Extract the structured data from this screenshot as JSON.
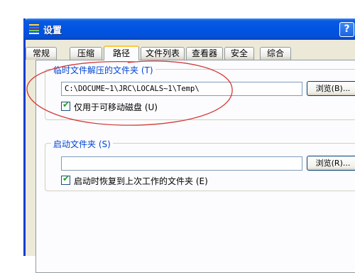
{
  "window": {
    "title": "设置",
    "help_label": "?"
  },
  "tabs": [
    {
      "label": "常规"
    },
    {
      "label": "压缩"
    },
    {
      "label": "路径"
    },
    {
      "label": "文件列表"
    },
    {
      "label": "查看器"
    },
    {
      "label": "安全"
    },
    {
      "label": "综合"
    }
  ],
  "active_tab": "路径",
  "temp_folder": {
    "group_label": "临时文件解压的文件夹 (T)",
    "path_value": "C:\\DOCUME~1\\JRC\\LOCALS~1\\Temp\\",
    "browse_label": "浏览(B)...",
    "checkbox_label": "仅用于可移动磁盘 (U)",
    "checkbox_checked": true
  },
  "startup_folder": {
    "group_label": "启动文件夹 (S)",
    "path_value": "",
    "browse_label": "浏览(R)...",
    "checkbox_label": "启动时恢复到上次工作的文件夹 (E)",
    "checkbox_checked": true
  },
  "colors": {
    "titlebar": "#0054e3",
    "group_label": "#0046d5",
    "annotation_ellipse": "#d23a3a",
    "active_tab_highlight": "#ffc83c"
  }
}
